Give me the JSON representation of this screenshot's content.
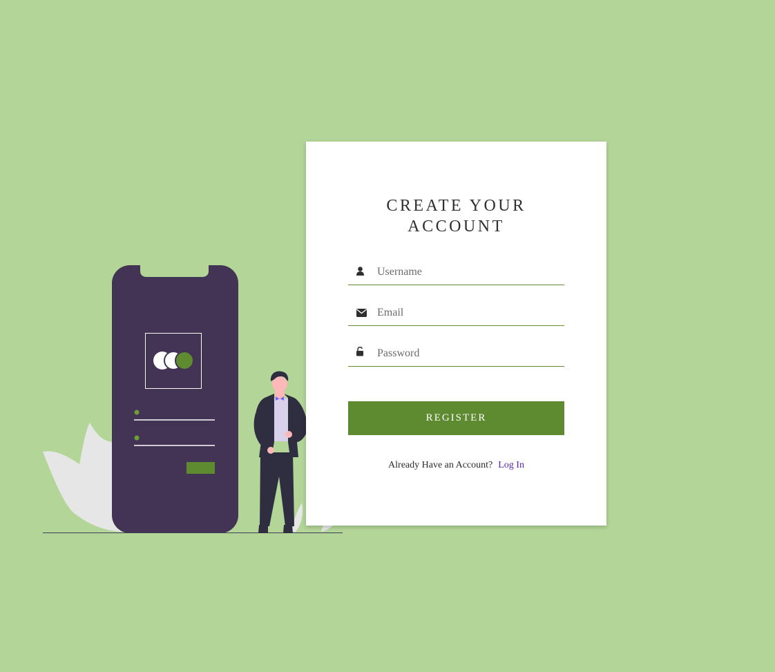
{
  "form": {
    "title": "CREATE YOUR ACCOUNT",
    "username_placeholder": "Username",
    "email_placeholder": "Email",
    "password_placeholder": "Password",
    "register_label": "REGISTER",
    "already_text": "Already Have an Account?",
    "login_label": "Log In"
  },
  "icons": {
    "username": "user-icon",
    "email": "envelope-icon",
    "password": "unlock-icon"
  },
  "colors": {
    "background": "#b3d698",
    "accent": "#5e8a30",
    "phone": "#433355",
    "link": "#5b21b6"
  }
}
